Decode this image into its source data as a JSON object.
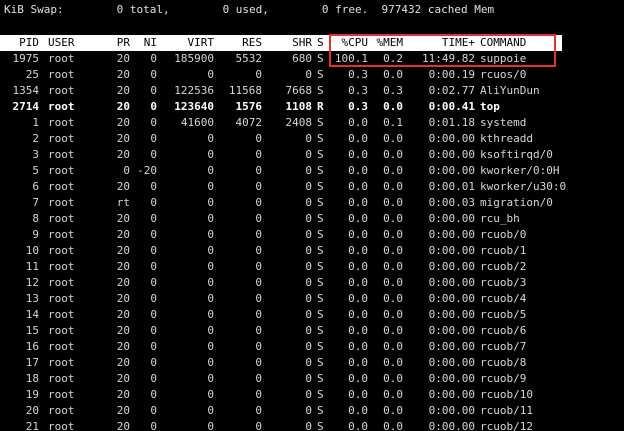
{
  "swap": {
    "label": "KiB Swap:",
    "total": "0 total,",
    "used": "0 used,",
    "free": "0 free.",
    "cached": "977432 cached Mem"
  },
  "header": {
    "pid": "PID",
    "user": "USER",
    "pr": "PR",
    "ni": "NI",
    "virt": "VIRT",
    "res": "RES",
    "shr": "SHR",
    "s": "S",
    "cpu": "%CPU",
    "mem": "%MEM",
    "time": "TIME+",
    "command": "COMMAND"
  },
  "processes": [
    {
      "pid": "1975",
      "user": "root",
      "pr": "20",
      "ni": "0",
      "virt": "185900",
      "res": "5532",
      "shr": "680",
      "s": "S",
      "cpu": "100.1",
      "mem": "0.2",
      "time": "11:49.82",
      "command": "suppoie",
      "bold": false
    },
    {
      "pid": "25",
      "user": "root",
      "pr": "20",
      "ni": "0",
      "virt": "0",
      "res": "0",
      "shr": "0",
      "s": "S",
      "cpu": "0.3",
      "mem": "0.0",
      "time": "0:00.19",
      "command": "rcuos/0",
      "bold": false
    },
    {
      "pid": "1354",
      "user": "root",
      "pr": "20",
      "ni": "0",
      "virt": "122536",
      "res": "11568",
      "shr": "7668",
      "s": "S",
      "cpu": "0.3",
      "mem": "0.3",
      "time": "0:02.77",
      "command": "AliYunDun",
      "bold": false
    },
    {
      "pid": "2714",
      "user": "root",
      "pr": "20",
      "ni": "0",
      "virt": "123640",
      "res": "1576",
      "shr": "1108",
      "s": "R",
      "cpu": "0.3",
      "mem": "0.0",
      "time": "0:00.41",
      "command": "top",
      "bold": true
    },
    {
      "pid": "1",
      "user": "root",
      "pr": "20",
      "ni": "0",
      "virt": "41600",
      "res": "4072",
      "shr": "2408",
      "s": "S",
      "cpu": "0.0",
      "mem": "0.1",
      "time": "0:01.18",
      "command": "systemd",
      "bold": false
    },
    {
      "pid": "2",
      "user": "root",
      "pr": "20",
      "ni": "0",
      "virt": "0",
      "res": "0",
      "shr": "0",
      "s": "S",
      "cpu": "0.0",
      "mem": "0.0",
      "time": "0:00.00",
      "command": "kthreadd",
      "bold": false
    },
    {
      "pid": "3",
      "user": "root",
      "pr": "20",
      "ni": "0",
      "virt": "0",
      "res": "0",
      "shr": "0",
      "s": "S",
      "cpu": "0.0",
      "mem": "0.0",
      "time": "0:00.00",
      "command": "ksoftirqd/0",
      "bold": false
    },
    {
      "pid": "5",
      "user": "root",
      "pr": "0",
      "ni": "-20",
      "virt": "0",
      "res": "0",
      "shr": "0",
      "s": "S",
      "cpu": "0.0",
      "mem": "0.0",
      "time": "0:00.00",
      "command": "kworker/0:0H",
      "bold": false
    },
    {
      "pid": "6",
      "user": "root",
      "pr": "20",
      "ni": "0",
      "virt": "0",
      "res": "0",
      "shr": "0",
      "s": "S",
      "cpu": "0.0",
      "mem": "0.0",
      "time": "0:00.01",
      "command": "kworker/u30:0",
      "bold": false
    },
    {
      "pid": "7",
      "user": "root",
      "pr": "rt",
      "ni": "0",
      "virt": "0",
      "res": "0",
      "shr": "0",
      "s": "S",
      "cpu": "0.0",
      "mem": "0.0",
      "time": "0:00.03",
      "command": "migration/0",
      "bold": false
    },
    {
      "pid": "8",
      "user": "root",
      "pr": "20",
      "ni": "0",
      "virt": "0",
      "res": "0",
      "shr": "0",
      "s": "S",
      "cpu": "0.0",
      "mem": "0.0",
      "time": "0:00.00",
      "command": "rcu_bh",
      "bold": false
    },
    {
      "pid": "9",
      "user": "root",
      "pr": "20",
      "ni": "0",
      "virt": "0",
      "res": "0",
      "shr": "0",
      "s": "S",
      "cpu": "0.0",
      "mem": "0.0",
      "time": "0:00.00",
      "command": "rcuob/0",
      "bold": false
    },
    {
      "pid": "10",
      "user": "root",
      "pr": "20",
      "ni": "0",
      "virt": "0",
      "res": "0",
      "shr": "0",
      "s": "S",
      "cpu": "0.0",
      "mem": "0.0",
      "time": "0:00.00",
      "command": "rcuob/1",
      "bold": false
    },
    {
      "pid": "11",
      "user": "root",
      "pr": "20",
      "ni": "0",
      "virt": "0",
      "res": "0",
      "shr": "0",
      "s": "S",
      "cpu": "0.0",
      "mem": "0.0",
      "time": "0:00.00",
      "command": "rcuob/2",
      "bold": false
    },
    {
      "pid": "12",
      "user": "root",
      "pr": "20",
      "ni": "0",
      "virt": "0",
      "res": "0",
      "shr": "0",
      "s": "S",
      "cpu": "0.0",
      "mem": "0.0",
      "time": "0:00.00",
      "command": "rcuob/3",
      "bold": false
    },
    {
      "pid": "13",
      "user": "root",
      "pr": "20",
      "ni": "0",
      "virt": "0",
      "res": "0",
      "shr": "0",
      "s": "S",
      "cpu": "0.0",
      "mem": "0.0",
      "time": "0:00.00",
      "command": "rcuob/4",
      "bold": false
    },
    {
      "pid": "14",
      "user": "root",
      "pr": "20",
      "ni": "0",
      "virt": "0",
      "res": "0",
      "shr": "0",
      "s": "S",
      "cpu": "0.0",
      "mem": "0.0",
      "time": "0:00.00",
      "command": "rcuob/5",
      "bold": false
    },
    {
      "pid": "15",
      "user": "root",
      "pr": "20",
      "ni": "0",
      "virt": "0",
      "res": "0",
      "shr": "0",
      "s": "S",
      "cpu": "0.0",
      "mem": "0.0",
      "time": "0:00.00",
      "command": "rcuob/6",
      "bold": false
    },
    {
      "pid": "16",
      "user": "root",
      "pr": "20",
      "ni": "0",
      "virt": "0",
      "res": "0",
      "shr": "0",
      "s": "S",
      "cpu": "0.0",
      "mem": "0.0",
      "time": "0:00.00",
      "command": "rcuob/7",
      "bold": false
    },
    {
      "pid": "17",
      "user": "root",
      "pr": "20",
      "ni": "0",
      "virt": "0",
      "res": "0",
      "shr": "0",
      "s": "S",
      "cpu": "0.0",
      "mem": "0.0",
      "time": "0:00.00",
      "command": "rcuob/8",
      "bold": false
    },
    {
      "pid": "18",
      "user": "root",
      "pr": "20",
      "ni": "0",
      "virt": "0",
      "res": "0",
      "shr": "0",
      "s": "S",
      "cpu": "0.0",
      "mem": "0.0",
      "time": "0:00.00",
      "command": "rcuob/9",
      "bold": false
    },
    {
      "pid": "19",
      "user": "root",
      "pr": "20",
      "ni": "0",
      "virt": "0",
      "res": "0",
      "shr": "0",
      "s": "S",
      "cpu": "0.0",
      "mem": "0.0",
      "time": "0:00.00",
      "command": "rcuob/10",
      "bold": false
    },
    {
      "pid": "20",
      "user": "root",
      "pr": "20",
      "ni": "0",
      "virt": "0",
      "res": "0",
      "shr": "0",
      "s": "S",
      "cpu": "0.0",
      "mem": "0.0",
      "time": "0:00.00",
      "command": "rcuob/11",
      "bold": false
    },
    {
      "pid": "21",
      "user": "root",
      "pr": "20",
      "ni": "0",
      "virt": "0",
      "res": "0",
      "shr": "0",
      "s": "S",
      "cpu": "0.0",
      "mem": "0.0",
      "time": "0:00.00",
      "command": "rcuob/12",
      "bold": false
    }
  ],
  "colors": {
    "background": "#000000",
    "text": "#d6d6d6",
    "header_bg": "#ffffff",
    "header_text": "#000000",
    "highlight_border": "#e0322e"
  }
}
